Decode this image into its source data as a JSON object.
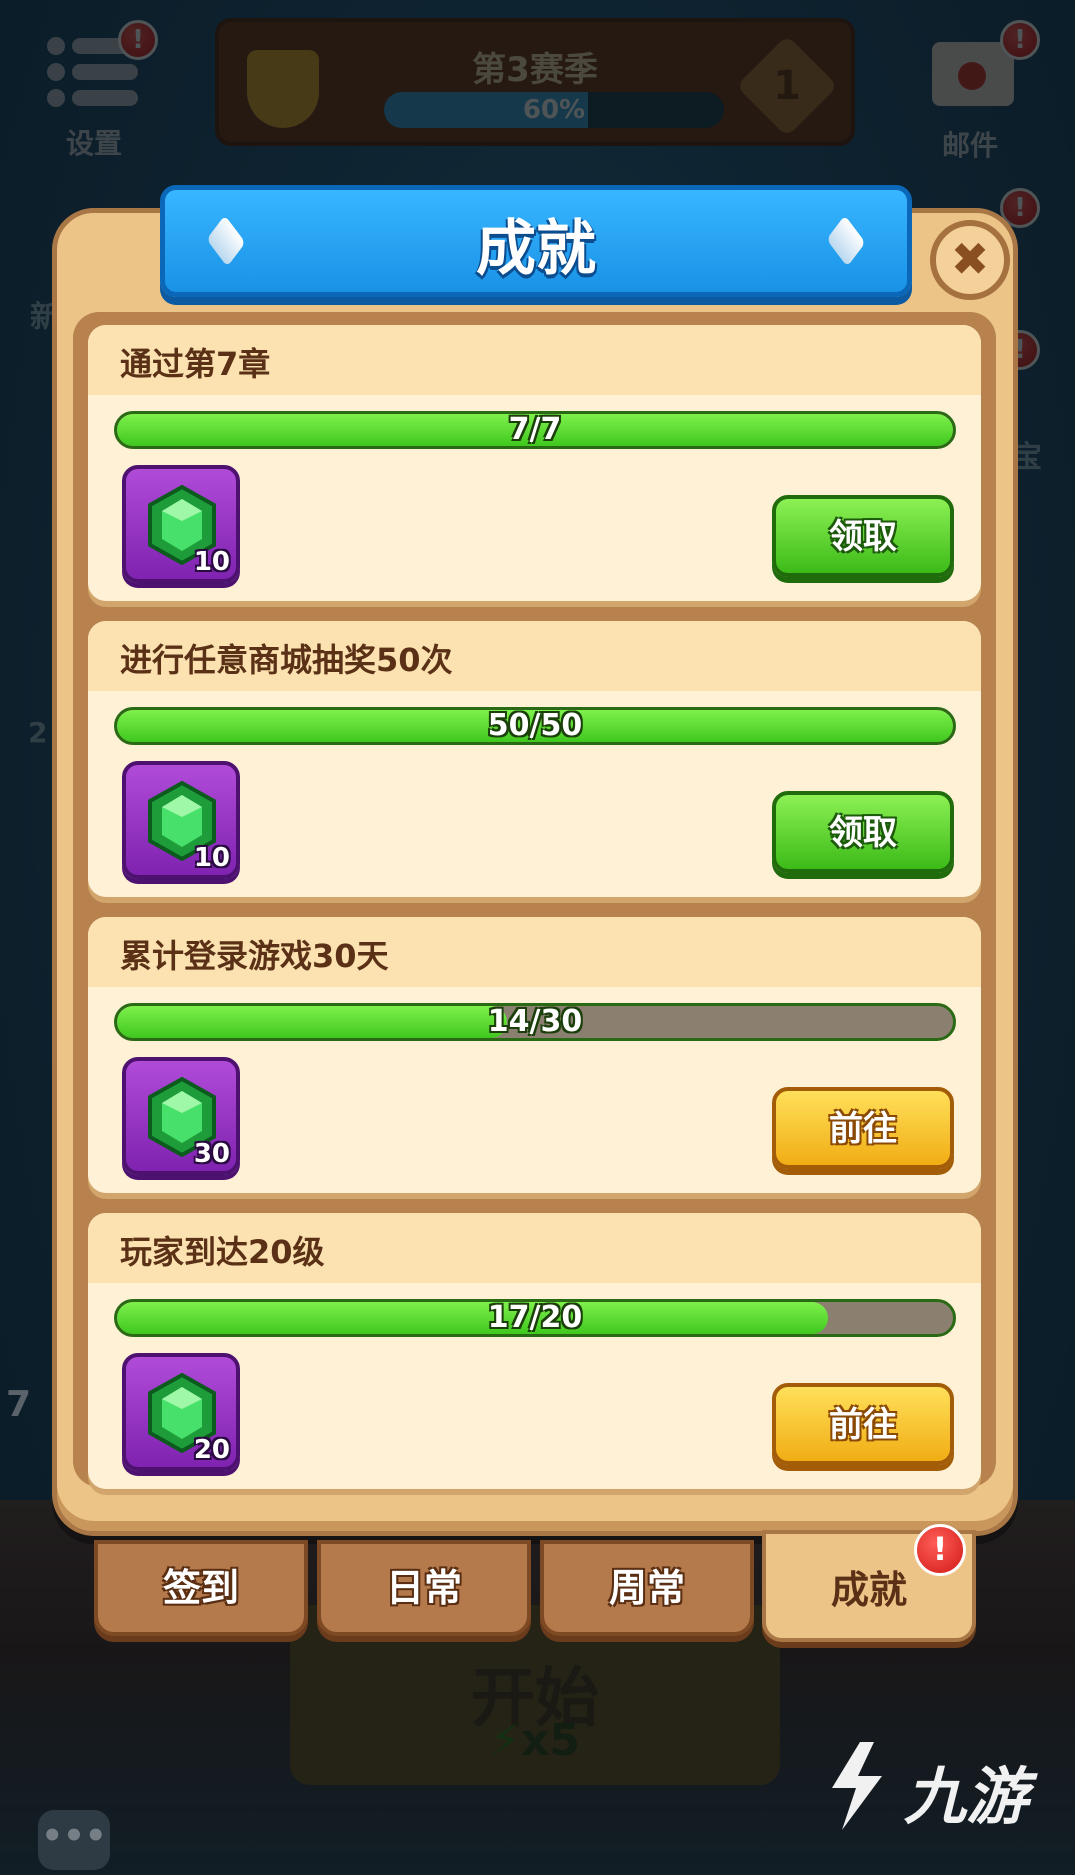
{
  "hud": {
    "settings_label": "设置",
    "mail_label": "邮件",
    "season_title": "第3赛季",
    "season_progress_percent": "60%",
    "season_progress_value": 0.6,
    "season_level": "1",
    "side_fragment_left": "新",
    "side_fragment_left2": "2",
    "side_fragment_left3": "7",
    "side_fragment_right": "宝"
  },
  "dialog": {
    "title": "成就",
    "close_symbol": "✖"
  },
  "achievements": [
    {
      "title": "通过第7章",
      "progress_text": "7/7",
      "progress": 1.0,
      "reward_count": "10",
      "action": "领取",
      "action_style": "green"
    },
    {
      "title": "进行任意商城抽奖50次",
      "progress_text": "50/50",
      "progress": 1.0,
      "reward_count": "10",
      "action": "领取",
      "action_style": "green"
    },
    {
      "title": "累计登录游戏30天",
      "progress_text": "14/30",
      "progress": 0.4667,
      "reward_count": "30",
      "action": "前往",
      "action_style": "yellow"
    },
    {
      "title": "玩家到达20级",
      "progress_text": "17/20",
      "progress": 0.85,
      "reward_count": "20",
      "action": "前往",
      "action_style": "yellow"
    }
  ],
  "tabs": [
    {
      "label": "签到",
      "active": false
    },
    {
      "label": "日常",
      "active": false
    },
    {
      "label": "周常",
      "active": false
    },
    {
      "label": "成就",
      "active": true,
      "badge": "!"
    }
  ],
  "start": {
    "label": "开始",
    "energy": "x5"
  },
  "chat_symbol": "•••",
  "watermark": "九游",
  "colors": {
    "panel": "#ecc487",
    "banner": "#1f9bf0",
    "progress_green": "#4fd12a",
    "button_green": "#3cbb18",
    "button_yellow": "#f1ad14",
    "reward_bg": "#9a35c8",
    "badge_red": "#e0231f"
  }
}
